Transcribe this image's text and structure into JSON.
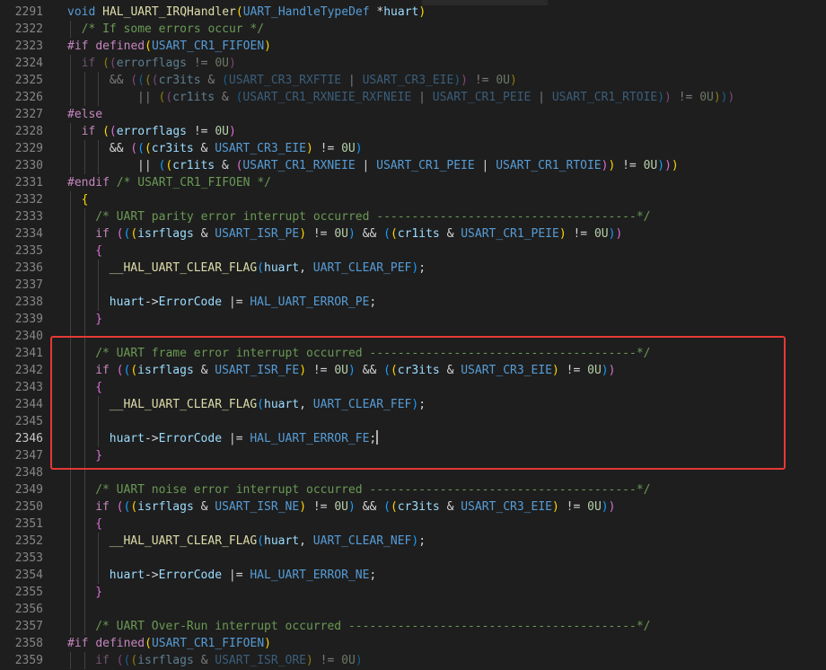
{
  "editor": {
    "active_line": "2346",
    "lines": [
      {
        "n": "2291",
        "indent": 0,
        "tokens": [
          [
            "t-typ",
            "void"
          ],
          [
            "t-txt",
            " "
          ],
          [
            "t-fn",
            "HAL_UART_IRQHandler"
          ],
          [
            "t-b1",
            "("
          ],
          [
            "t-typ",
            "UART_HandleTypeDef"
          ],
          [
            "t-txt",
            " *"
          ],
          [
            "t-var",
            "huart"
          ],
          [
            "t-b1",
            ")"
          ]
        ]
      },
      {
        "n": "2322",
        "indent": 1,
        "tokens": [
          [
            "t-cm",
            "/* If some errors occur */"
          ]
        ]
      },
      {
        "n": "2323",
        "indent": 0,
        "tokens": [
          [
            "t-pp",
            "#if"
          ],
          [
            "t-txt",
            " "
          ],
          [
            "t-pp",
            "defined"
          ],
          [
            "t-b1",
            "("
          ],
          [
            "t-mac",
            "USART_CR1_FIFOEN"
          ],
          [
            "t-b1",
            ")"
          ]
        ]
      },
      {
        "n": "2324",
        "indent": 1,
        "dim": true,
        "tokens": [
          [
            "t-kw",
            "if"
          ],
          [
            "t-txt",
            " "
          ],
          [
            "t-b1",
            "("
          ],
          [
            "t-b2",
            "("
          ],
          [
            "t-var",
            "errorflags"
          ],
          [
            "t-txt",
            " != "
          ],
          [
            "t-num",
            "0U"
          ],
          [
            "t-b2",
            ")"
          ]
        ]
      },
      {
        "n": "2325",
        "indent": 3,
        "dim": true,
        "tokens": [
          [
            "t-txt",
            "&& "
          ],
          [
            "t-b2",
            "("
          ],
          [
            "t-b3",
            "("
          ],
          [
            "t-b1",
            "("
          ],
          [
            "t-b2",
            "("
          ],
          [
            "t-var",
            "cr3its"
          ],
          [
            "t-txt",
            " & "
          ],
          [
            "t-b3",
            "("
          ],
          [
            "t-mac",
            "USART_CR3_RXFTIE"
          ],
          [
            "t-txt",
            " | "
          ],
          [
            "t-mac",
            "USART_CR3_EIE"
          ],
          [
            "t-b3",
            ")"
          ],
          [
            "t-b2",
            ")"
          ],
          [
            "t-txt",
            " != "
          ],
          [
            "t-num",
            "0U"
          ],
          [
            "t-b1",
            ")"
          ]
        ]
      },
      {
        "n": "2326",
        "indent": 5,
        "dim": true,
        "tokens": [
          [
            "t-txt",
            "|| "
          ],
          [
            "t-b1",
            "("
          ],
          [
            "t-b2",
            "("
          ],
          [
            "t-var",
            "cr1its"
          ],
          [
            "t-txt",
            " & "
          ],
          [
            "t-b3",
            "("
          ],
          [
            "t-mac",
            "USART_CR1_RXNEIE_RXFNEIE"
          ],
          [
            "t-txt",
            " | "
          ],
          [
            "t-mac",
            "USART_CR1_PEIE"
          ],
          [
            "t-txt",
            " | "
          ],
          [
            "t-mac",
            "USART_CR1_RTOIE"
          ],
          [
            "t-b3",
            ")"
          ],
          [
            "t-b2",
            ")"
          ],
          [
            "t-txt",
            " != "
          ],
          [
            "t-num",
            "0U"
          ],
          [
            "t-b1",
            ")"
          ],
          [
            "t-b3",
            ")"
          ],
          [
            "t-b2",
            ")"
          ]
        ]
      },
      {
        "n": "2327",
        "indent": 0,
        "tokens": [
          [
            "t-pp",
            "#else"
          ]
        ]
      },
      {
        "n": "2328",
        "indent": 1,
        "tokens": [
          [
            "t-kw",
            "if"
          ],
          [
            "t-txt",
            " "
          ],
          [
            "t-b1",
            "("
          ],
          [
            "t-b2",
            "("
          ],
          [
            "t-var",
            "errorflags"
          ],
          [
            "t-txt",
            " != "
          ],
          [
            "t-num",
            "0U"
          ],
          [
            "t-b2",
            ")"
          ]
        ]
      },
      {
        "n": "2329",
        "indent": 3,
        "tokens": [
          [
            "t-txt",
            "&& "
          ],
          [
            "t-b2",
            "("
          ],
          [
            "t-b3",
            "("
          ],
          [
            "t-b1",
            "("
          ],
          [
            "t-var",
            "cr3its"
          ],
          [
            "t-txt",
            " & "
          ],
          [
            "t-mac",
            "USART_CR3_EIE"
          ],
          [
            "t-b1",
            ")"
          ],
          [
            "t-txt",
            " != "
          ],
          [
            "t-num",
            "0U"
          ],
          [
            "t-b3",
            ")"
          ]
        ]
      },
      {
        "n": "2330",
        "indent": 5,
        "tokens": [
          [
            "t-txt",
            "|| "
          ],
          [
            "t-b3",
            "("
          ],
          [
            "t-b1",
            "("
          ],
          [
            "t-var",
            "cr1its"
          ],
          [
            "t-txt",
            " & "
          ],
          [
            "t-b2",
            "("
          ],
          [
            "t-mac",
            "USART_CR1_RXNEIE"
          ],
          [
            "t-txt",
            " | "
          ],
          [
            "t-mac",
            "USART_CR1_PEIE"
          ],
          [
            "t-txt",
            " | "
          ],
          [
            "t-mac",
            "USART_CR1_RTOIE"
          ],
          [
            "t-b2",
            ")"
          ],
          [
            "t-b1",
            ")"
          ],
          [
            "t-txt",
            " != "
          ],
          [
            "t-num",
            "0U"
          ],
          [
            "t-b3",
            ")"
          ],
          [
            "t-b2",
            ")"
          ],
          [
            "t-b1",
            ")"
          ]
        ]
      },
      {
        "n": "2331",
        "indent": 0,
        "tokens": [
          [
            "t-pp",
            "#endif"
          ],
          [
            "t-txt",
            " "
          ],
          [
            "t-cm",
            "/* USART_CR1_FIFOEN */"
          ]
        ]
      },
      {
        "n": "2332",
        "indent": 1,
        "tokens": [
          [
            "t-b1",
            "{"
          ]
        ]
      },
      {
        "n": "2333",
        "indent": 2,
        "tokens": [
          [
            "t-cm",
            "/* UART parity error interrupt occurred -------------------------------------*/"
          ]
        ]
      },
      {
        "n": "2334",
        "indent": 2,
        "tokens": [
          [
            "t-kw",
            "if"
          ],
          [
            "t-txt",
            " "
          ],
          [
            "t-b2",
            "("
          ],
          [
            "t-b3",
            "("
          ],
          [
            "t-b1",
            "("
          ],
          [
            "t-var",
            "isrflags"
          ],
          [
            "t-txt",
            " & "
          ],
          [
            "t-mac",
            "USART_ISR_PE"
          ],
          [
            "t-b1",
            ")"
          ],
          [
            "t-txt",
            " != "
          ],
          [
            "t-num",
            "0U"
          ],
          [
            "t-b3",
            ")"
          ],
          [
            "t-txt",
            " && "
          ],
          [
            "t-b3",
            "("
          ],
          [
            "t-b1",
            "("
          ],
          [
            "t-var",
            "cr1its"
          ],
          [
            "t-txt",
            " & "
          ],
          [
            "t-mac",
            "USART_CR1_PEIE"
          ],
          [
            "t-b1",
            ")"
          ],
          [
            "t-txt",
            " != "
          ],
          [
            "t-num",
            "0U"
          ],
          [
            "t-b3",
            ")"
          ],
          [
            "t-b2",
            ")"
          ]
        ]
      },
      {
        "n": "2335",
        "indent": 2,
        "tokens": [
          [
            "t-b2",
            "{"
          ]
        ]
      },
      {
        "n": "2336",
        "indent": 3,
        "tokens": [
          [
            "t-fn",
            "__HAL_UART_CLEAR_FLAG"
          ],
          [
            "t-b3",
            "("
          ],
          [
            "t-var",
            "huart"
          ],
          [
            "t-txt",
            ", "
          ],
          [
            "t-mac",
            "UART_CLEAR_PEF"
          ],
          [
            "t-b3",
            ")"
          ],
          [
            "t-txt",
            ";"
          ]
        ]
      },
      {
        "n": "2337",
        "indent": 3,
        "tokens": []
      },
      {
        "n": "2338",
        "indent": 3,
        "tokens": [
          [
            "t-var",
            "huart"
          ],
          [
            "t-txt",
            "->"
          ],
          [
            "t-var",
            "ErrorCode"
          ],
          [
            "t-txt",
            " |= "
          ],
          [
            "t-mac",
            "HAL_UART_ERROR_PE"
          ],
          [
            "t-txt",
            ";"
          ]
        ]
      },
      {
        "n": "2339",
        "indent": 2,
        "tokens": [
          [
            "t-b2",
            "}"
          ]
        ]
      },
      {
        "n": "2340",
        "indent": 2,
        "tokens": []
      },
      {
        "n": "2341",
        "indent": 2,
        "tokens": [
          [
            "t-cm",
            "/* UART frame error interrupt occurred --------------------------------------*/"
          ]
        ]
      },
      {
        "n": "2342",
        "indent": 2,
        "tokens": [
          [
            "t-kw",
            "if"
          ],
          [
            "t-txt",
            " "
          ],
          [
            "t-b2",
            "("
          ],
          [
            "t-b3",
            "("
          ],
          [
            "t-b1",
            "("
          ],
          [
            "t-var",
            "isrflags"
          ],
          [
            "t-txt",
            " & "
          ],
          [
            "t-mac",
            "USART_ISR_FE"
          ],
          [
            "t-b1",
            ")"
          ],
          [
            "t-txt",
            " != "
          ],
          [
            "t-num",
            "0U"
          ],
          [
            "t-b3",
            ")"
          ],
          [
            "t-txt",
            " && "
          ],
          [
            "t-b3",
            "("
          ],
          [
            "t-b1",
            "("
          ],
          [
            "t-var",
            "cr3its"
          ],
          [
            "t-txt",
            " & "
          ],
          [
            "t-mac",
            "USART_CR3_EIE"
          ],
          [
            "t-b1",
            ")"
          ],
          [
            "t-txt",
            " != "
          ],
          [
            "t-num",
            "0U"
          ],
          [
            "t-b3",
            ")"
          ],
          [
            "t-b2",
            ")"
          ]
        ]
      },
      {
        "n": "2343",
        "indent": 2,
        "tokens": [
          [
            "t-b2",
            "{"
          ]
        ]
      },
      {
        "n": "2344",
        "indent": 3,
        "tokens": [
          [
            "t-fn",
            "__HAL_UART_CLEAR_FLAG"
          ],
          [
            "t-b3",
            "("
          ],
          [
            "t-var",
            "huart"
          ],
          [
            "t-txt",
            ", "
          ],
          [
            "t-mac",
            "UART_CLEAR_FEF"
          ],
          [
            "t-b3",
            ")"
          ],
          [
            "t-txt",
            ";"
          ]
        ]
      },
      {
        "n": "2345",
        "indent": 3,
        "tokens": []
      },
      {
        "n": "2346",
        "indent": 3,
        "cursor": true,
        "tokens": [
          [
            "t-var",
            "huart"
          ],
          [
            "t-txt",
            "->"
          ],
          [
            "t-var",
            "ErrorCode"
          ],
          [
            "t-txt",
            " |= "
          ],
          [
            "t-mac",
            "HAL_UART_ERROR_FE"
          ],
          [
            "t-txt",
            ";"
          ]
        ]
      },
      {
        "n": "2347",
        "indent": 2,
        "tokens": [
          [
            "t-b2",
            "}"
          ]
        ]
      },
      {
        "n": "2348",
        "indent": 2,
        "tokens": []
      },
      {
        "n": "2349",
        "indent": 2,
        "tokens": [
          [
            "t-cm",
            "/* UART noise error interrupt occurred --------------------------------------*/"
          ]
        ]
      },
      {
        "n": "2350",
        "indent": 2,
        "tokens": [
          [
            "t-kw",
            "if"
          ],
          [
            "t-txt",
            " "
          ],
          [
            "t-b2",
            "("
          ],
          [
            "t-b3",
            "("
          ],
          [
            "t-b1",
            "("
          ],
          [
            "t-var",
            "isrflags"
          ],
          [
            "t-txt",
            " & "
          ],
          [
            "t-mac",
            "USART_ISR_NE"
          ],
          [
            "t-b1",
            ")"
          ],
          [
            "t-txt",
            " != "
          ],
          [
            "t-num",
            "0U"
          ],
          [
            "t-b3",
            ")"
          ],
          [
            "t-txt",
            " && "
          ],
          [
            "t-b3",
            "("
          ],
          [
            "t-b1",
            "("
          ],
          [
            "t-var",
            "cr3its"
          ],
          [
            "t-txt",
            " & "
          ],
          [
            "t-mac",
            "USART_CR3_EIE"
          ],
          [
            "t-b1",
            ")"
          ],
          [
            "t-txt",
            " != "
          ],
          [
            "t-num",
            "0U"
          ],
          [
            "t-b3",
            ")"
          ],
          [
            "t-b2",
            ")"
          ]
        ]
      },
      {
        "n": "2351",
        "indent": 2,
        "tokens": [
          [
            "t-b2",
            "{"
          ]
        ]
      },
      {
        "n": "2352",
        "indent": 3,
        "tokens": [
          [
            "t-fn",
            "__HAL_UART_CLEAR_FLAG"
          ],
          [
            "t-b3",
            "("
          ],
          [
            "t-var",
            "huart"
          ],
          [
            "t-txt",
            ", "
          ],
          [
            "t-mac",
            "UART_CLEAR_NEF"
          ],
          [
            "t-b3",
            ")"
          ],
          [
            "t-txt",
            ";"
          ]
        ]
      },
      {
        "n": "2353",
        "indent": 3,
        "tokens": []
      },
      {
        "n": "2354",
        "indent": 3,
        "tokens": [
          [
            "t-var",
            "huart"
          ],
          [
            "t-txt",
            "->"
          ],
          [
            "t-var",
            "ErrorCode"
          ],
          [
            "t-txt",
            " |= "
          ],
          [
            "t-mac",
            "HAL_UART_ERROR_NE"
          ],
          [
            "t-txt",
            ";"
          ]
        ]
      },
      {
        "n": "2355",
        "indent": 2,
        "tokens": [
          [
            "t-b2",
            "}"
          ]
        ]
      },
      {
        "n": "2356",
        "indent": 2,
        "tokens": []
      },
      {
        "n": "2357",
        "indent": 2,
        "tokens": [
          [
            "t-cm",
            "/* UART Over-Run interrupt occurred -----------------------------------------*/"
          ]
        ]
      },
      {
        "n": "2358",
        "indent": 0,
        "tokens": [
          [
            "t-pp",
            "#if"
          ],
          [
            "t-txt",
            " "
          ],
          [
            "t-pp",
            "defined"
          ],
          [
            "t-b1",
            "("
          ],
          [
            "t-mac",
            "USART_CR1_FIFOEN"
          ],
          [
            "t-b1",
            ")"
          ]
        ]
      },
      {
        "n": "2359",
        "indent": 2,
        "dim": true,
        "tokens": [
          [
            "t-kw",
            "if"
          ],
          [
            "t-txt",
            " "
          ],
          [
            "t-b2",
            "("
          ],
          [
            "t-b3",
            "("
          ],
          [
            "t-b1",
            "("
          ],
          [
            "t-var",
            "isrflags"
          ],
          [
            "t-txt",
            " & "
          ],
          [
            "t-mac",
            "USART_ISR_ORE"
          ],
          [
            "t-b1",
            ")"
          ],
          [
            "t-txt",
            " != "
          ],
          [
            "t-num",
            "0U"
          ],
          [
            "t-b3",
            ")"
          ]
        ]
      }
    ]
  },
  "highlight": {
    "color": "#e53935"
  }
}
